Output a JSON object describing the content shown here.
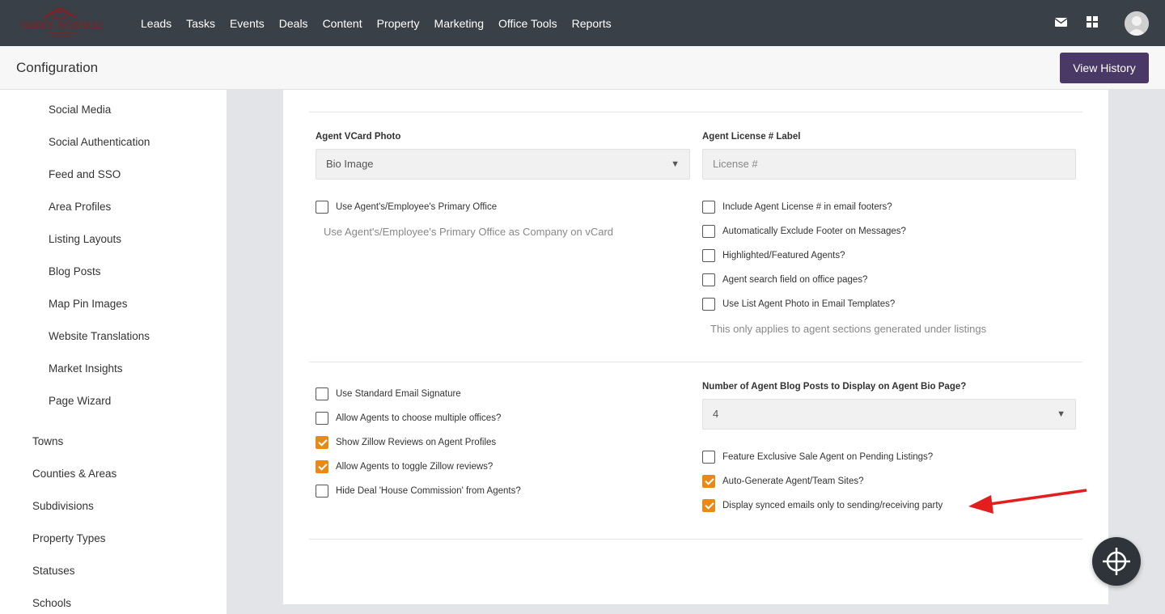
{
  "brand": {
    "logo_text": "HARRY NORMAN"
  },
  "nav": {
    "items": [
      "Leads",
      "Tasks",
      "Events",
      "Deals",
      "Content",
      "Property",
      "Marketing",
      "Office Tools",
      "Reports"
    ],
    "icons": {
      "mail": "mail-icon",
      "apps": "grid-icon",
      "avatar": "avatar"
    }
  },
  "header": {
    "title": "Configuration",
    "view_history": "View History"
  },
  "sidebar": {
    "subitems": [
      "Social Media",
      "Social Authentication",
      "Feed and SSO",
      "Area Profiles",
      "Listing Layouts",
      "Blog Posts",
      "Map Pin Images",
      "Website Translations",
      "Market Insights",
      "Page Wizard"
    ],
    "items": [
      "Towns",
      "Counties & Areas",
      "Subdivisions",
      "Property Types",
      "Statuses",
      "Schools"
    ]
  },
  "section1": {
    "vcard_label": "Agent VCard Photo",
    "vcard_value": "Bio Image",
    "license_label": "Agent License # Label",
    "license_placeholder": "License #",
    "left_checks": [
      {
        "label": "Use Agent's/Employee's Primary Office",
        "checked": false
      }
    ],
    "left_help": "Use Agent's/Employee's Primary Office as Company on vCard",
    "right_checks": [
      {
        "label": "Include Agent License # in email footers?",
        "checked": false
      },
      {
        "label": "Automatically Exclude Footer on Messages?",
        "checked": false
      },
      {
        "label": "Highlighted/Featured Agents?",
        "checked": false
      },
      {
        "label": "Agent search field on office pages?",
        "checked": false
      },
      {
        "label": "Use List Agent Photo in Email Templates?",
        "checked": false
      }
    ],
    "right_help": "This only applies to agent sections generated under listings"
  },
  "section2": {
    "left_checks": [
      {
        "label": "Use Standard Email Signature",
        "checked": false
      },
      {
        "label": "Allow Agents to choose multiple offices?",
        "checked": false
      },
      {
        "label": "Show Zillow Reviews on Agent Profiles",
        "checked": true
      },
      {
        "label": "Allow Agents to toggle Zillow reviews?",
        "checked": true
      },
      {
        "label": "Hide Deal 'House Commission' from Agents?",
        "checked": false
      }
    ],
    "blog_label": "Number of Agent Blog Posts to Display on Agent Bio Page?",
    "blog_value": "4",
    "right_checks": [
      {
        "label": "Feature Exclusive Sale Agent on Pending Listings?",
        "checked": false
      },
      {
        "label": "Auto-Generate Agent/Team Sites?",
        "checked": true
      },
      {
        "label": "Display synced emails only to sending/receiving party",
        "checked": true
      }
    ]
  },
  "colors": {
    "nav_bg": "#3a4048",
    "accent": "#4a3966",
    "check": "#e98a17",
    "annotation": "#e31e1e"
  }
}
